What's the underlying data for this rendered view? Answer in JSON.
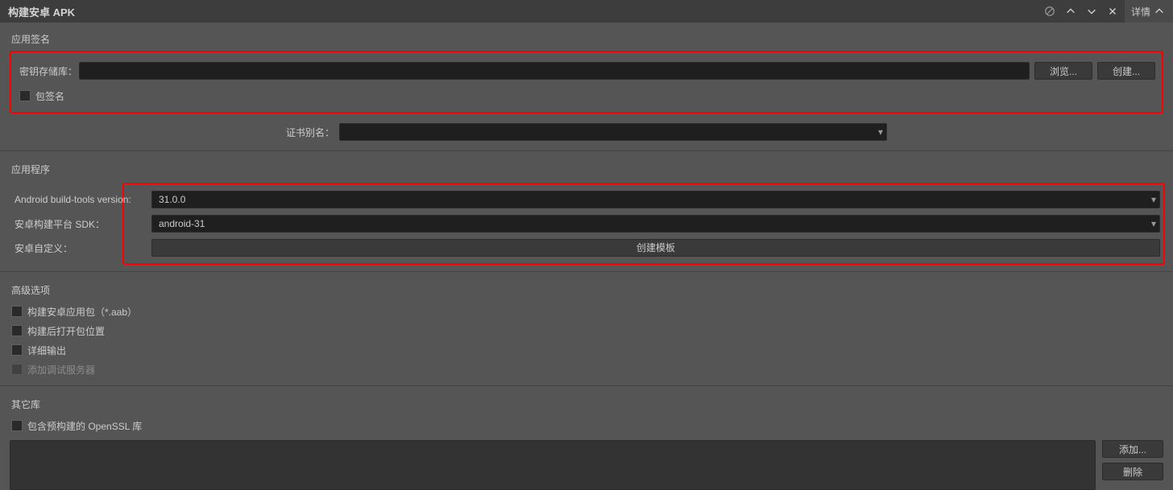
{
  "titlebar": {
    "title": "构建安卓 APK",
    "details_label": "详情"
  },
  "signing": {
    "section_title": "应用签名",
    "keystore_label": "密钥存储库：",
    "keystore_value": "",
    "browse_label": "浏览...",
    "create_label": "创建...",
    "include_signature_label": "包签名",
    "cert_alias_label": "证书别名："
  },
  "application": {
    "section_title": "应用程序",
    "buildtools_label": "Android build-tools version:",
    "buildtools_value": "31.0.0",
    "sdk_label": "安卓构建平台 SDK：",
    "sdk_value": "android-31",
    "custom_label": "安卓自定义：",
    "create_template_label": "创建模板"
  },
  "advanced": {
    "section_title": "高级选项",
    "aab_label": "构建安卓应用包（*.aab）",
    "open_after_label": "构建后打开包位置",
    "verbose_label": "详细输出",
    "debug_server_label": "添加调试服务器"
  },
  "otherlib": {
    "section_title": "其它库",
    "openssl_label": "包含预构建的 OpenSSL 库",
    "add_label": "添加...",
    "remove_label": "删除"
  }
}
